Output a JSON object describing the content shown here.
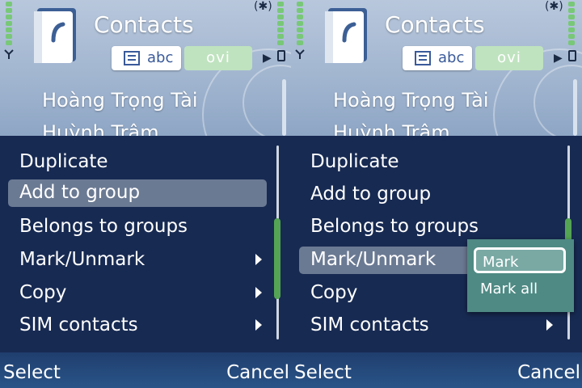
{
  "app": {
    "title": "Contacts"
  },
  "tabs": {
    "abc": "abc",
    "ovi": "ovi"
  },
  "contacts": [
    "Hoàng Trọng Tài",
    "Huỳnh Trâm"
  ],
  "menu": {
    "items": [
      {
        "label": "Duplicate",
        "has_submenu": false
      },
      {
        "label": "Add to group",
        "has_submenu": false
      },
      {
        "label": "Belongs to groups",
        "has_submenu": false
      },
      {
        "label": "Mark/Unmark",
        "has_submenu": true
      },
      {
        "label": "Copy",
        "has_submenu": true
      },
      {
        "label": "SIM contacts",
        "has_submenu": true
      }
    ],
    "left_selected": "Add to group",
    "right_selected": "Mark/Unmark"
  },
  "submenu": {
    "items": [
      "Mark",
      "Mark all"
    ],
    "selected": "Mark"
  },
  "softkeys": {
    "left": "Select",
    "right": "Cancel"
  },
  "icons": {
    "status_connectivity": "bluetooth-icon",
    "app": "contacts-book-icon"
  },
  "colors": {
    "menu_bg": "#172a52",
    "highlight": "#6b7a93",
    "submenu_bg": "#4f8a84",
    "accent_green": "#54a454"
  }
}
